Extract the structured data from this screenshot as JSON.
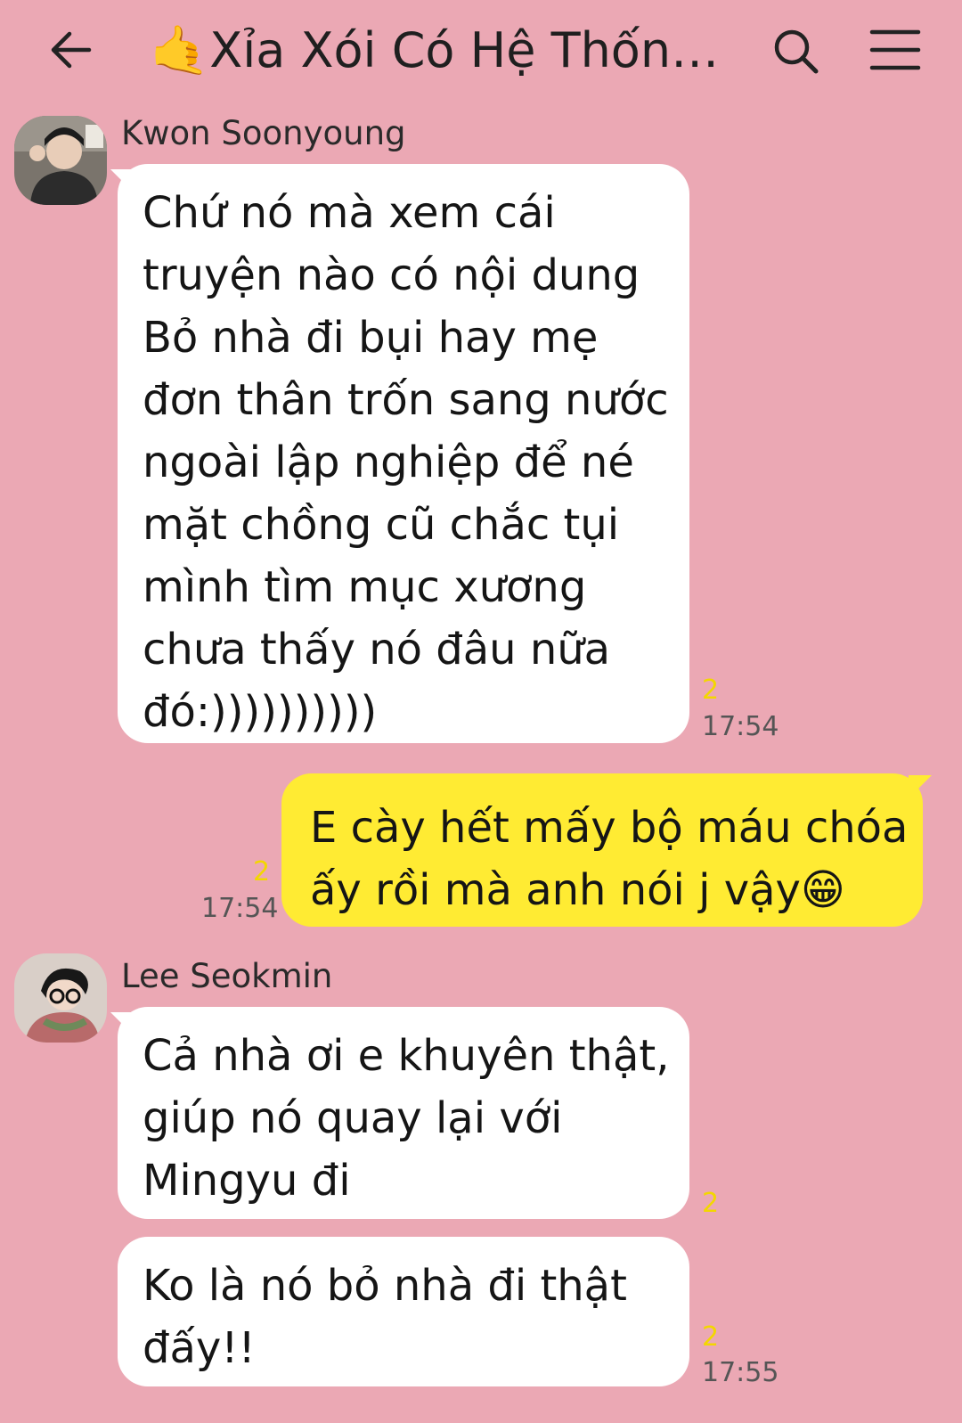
{
  "header": {
    "title": "🤙Xỉa Xói Có Hệ Thống..."
  },
  "messages": [
    {
      "sender": "Kwon Soonyoung",
      "lines": [
        "Chứ nó mà xem cái",
        "truyện nào có nội dung",
        "Bỏ nhà đi bụi hay mẹ",
        "đơn thân trốn sang nước",
        "ngoài lập nghiệp để né",
        "mặt chồng cũ chắc tụi",
        "mình tìm mục xương",
        "chưa thấy nó đâu nữa",
        "đó:))))))))))"
      ],
      "unread": "2",
      "time": "17:54"
    },
    {
      "lines": [
        "E cày hết mấy bộ máu chóa",
        "ấy rồi mà anh nói j vậy😁"
      ],
      "unread": "2",
      "time": "17:54"
    },
    {
      "sender": "Lee Seokmin",
      "lines": [
        "Cả nhà ơi e khuyên thật,",
        "giúp nó quay lại với",
        "Mingyu đi"
      ],
      "unread": "2"
    },
    {
      "lines": [
        "Ko là nó bỏ nhà đi thật",
        "đấy!!"
      ],
      "unread": "2",
      "time": "17:55"
    }
  ],
  "colors": {
    "background": "#EBA8B4",
    "incoming_bubble": "#FFFFFF",
    "outgoing_bubble": "#FFEB33",
    "unread": "#F3D700"
  }
}
